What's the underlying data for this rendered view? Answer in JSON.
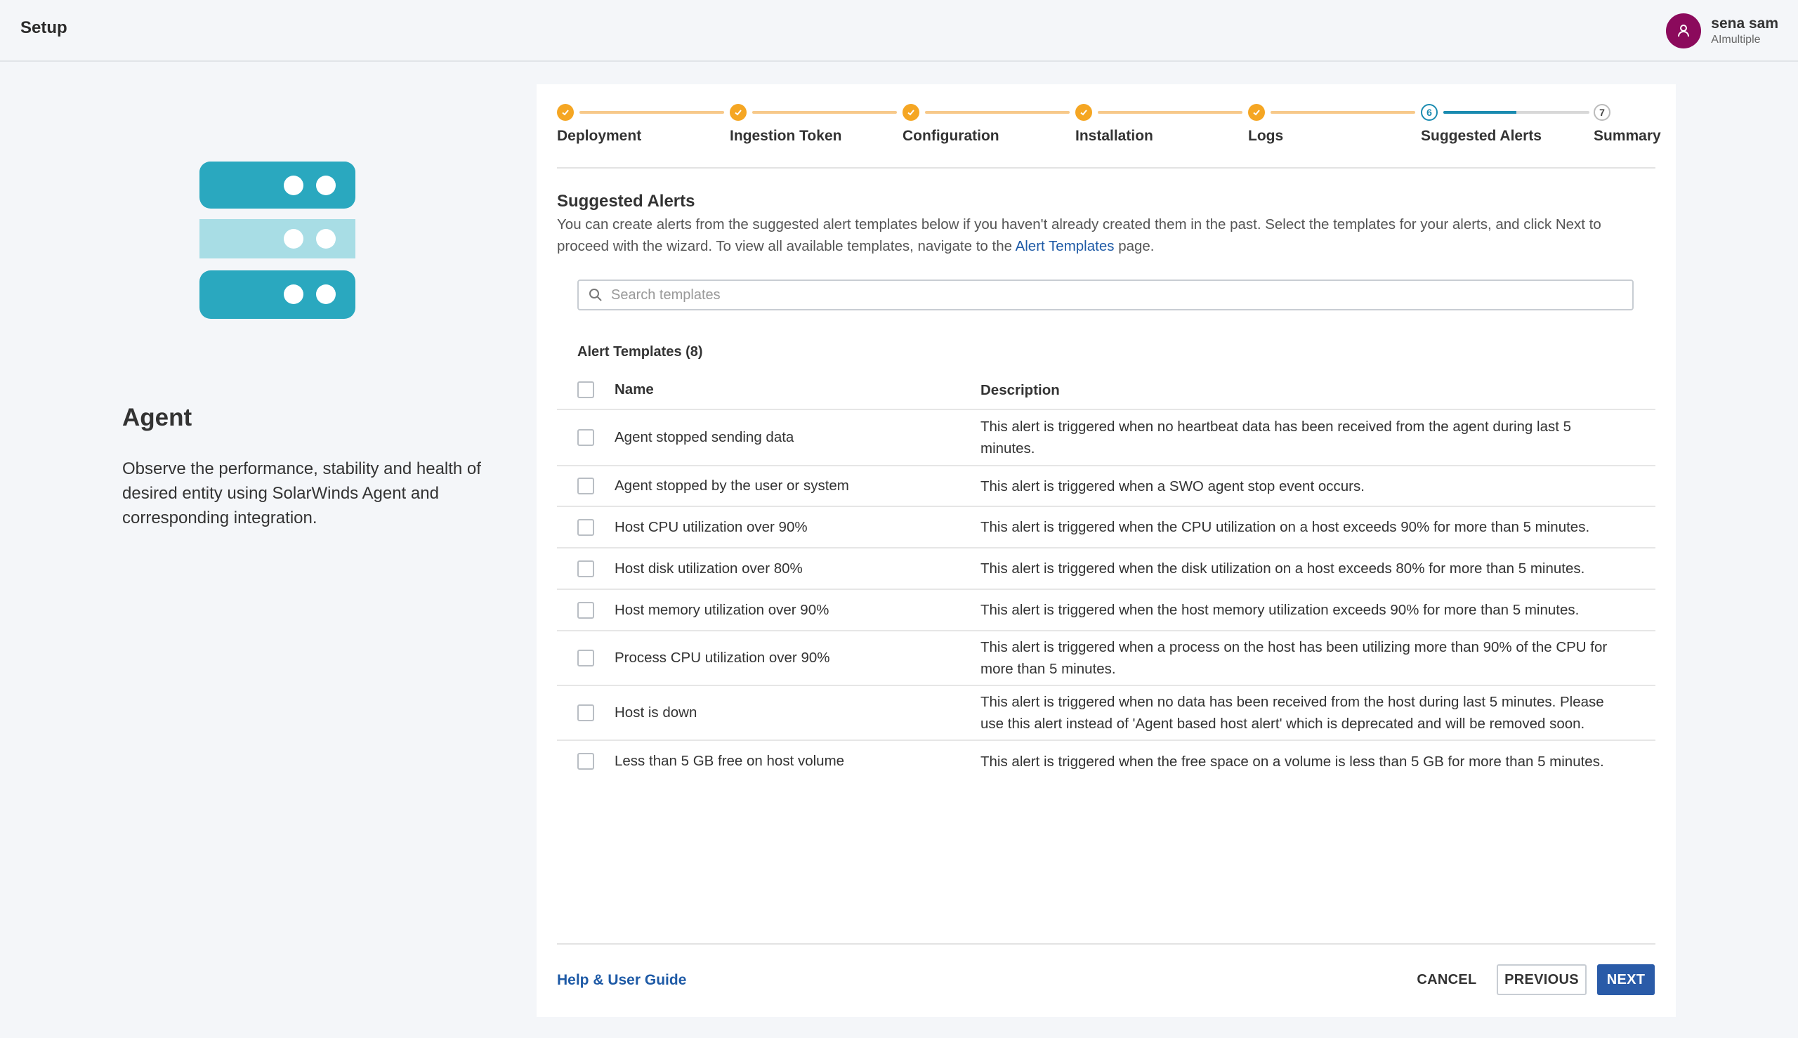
{
  "header": {
    "title": "Setup",
    "user_name": "sena sam",
    "user_org": "AImultiple"
  },
  "colors": {
    "accent": "#2a5ba8",
    "step_done": "#f5a623",
    "step_current": "#1a8bb0",
    "avatar": "#8b0a5c",
    "agent_icon": "#2aa8bf"
  },
  "left": {
    "icon": "agent-server-icon",
    "title": "Agent",
    "description": "Observe the performance, stability and health of desired entity using SolarWinds Agent and corresponding integration."
  },
  "stepper": {
    "steps": [
      {
        "label": "Deployment",
        "state": "done"
      },
      {
        "label": "Ingestion Token",
        "state": "done"
      },
      {
        "label": "Configuration",
        "state": "done"
      },
      {
        "label": "Installation",
        "state": "done"
      },
      {
        "label": "Logs",
        "state": "done"
      },
      {
        "label": "Suggested Alerts",
        "state": "current",
        "number": "6"
      },
      {
        "label": "Summary",
        "state": "todo",
        "number": "7"
      }
    ],
    "current_progress": 0.5
  },
  "section": {
    "title": "Suggested Alerts",
    "desc_before": "You can create alerts from the suggested alert templates below if you haven't already created them in the past. Select the templates for your alerts, and click Next to proceed with the wizard. To view all available templates, navigate to the ",
    "desc_link": "Alert Templates",
    "desc_after": " page."
  },
  "search": {
    "placeholder": "Search templates"
  },
  "templates": {
    "count_label": "Alert Templates (8)",
    "columns": {
      "name": "Name",
      "description": "Description"
    },
    "rows": [
      {
        "name": "Agent stopped sending data",
        "description": "This alert is triggered when no heartbeat data has been received from the agent during last 5 minutes."
      },
      {
        "name": "Agent stopped by the user or system",
        "description": "This alert is triggered when a SWO agent stop event occurs."
      },
      {
        "name": "Host CPU utilization over 90%",
        "description": "This alert is triggered when the CPU utilization on a host exceeds 90% for more than 5 minutes."
      },
      {
        "name": "Host disk utilization over 80%",
        "description": "This alert is triggered when the disk utilization on a host exceeds 80% for more than 5 minutes."
      },
      {
        "name": "Host memory utilization over 90%",
        "description": "This alert is triggered when the host memory utilization exceeds 90% for more than 5 minutes."
      },
      {
        "name": "Process CPU utilization over 90%",
        "description": "This alert is triggered when a process on the host has been utilizing more than 90% of the CPU for more than 5 minutes."
      },
      {
        "name": "Host is down",
        "description": "This alert is triggered when no data has been received from the host during last 5 minutes. Please use this alert instead of 'Agent based host alert' which is deprecated and will be removed soon."
      },
      {
        "name": "Less than 5 GB free on host volume",
        "description": "This alert is triggered when the free space on a volume is less than 5 GB for more than 5 minutes."
      }
    ]
  },
  "footer": {
    "help_link": "Help & User Guide",
    "cancel": "CANCEL",
    "previous": "PREVIOUS",
    "next": "NEXT"
  }
}
